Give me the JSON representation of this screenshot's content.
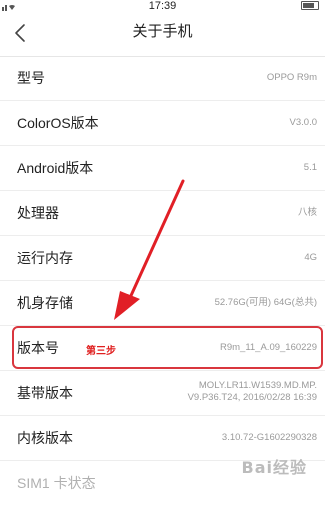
{
  "status_bar": {
    "time": "17:39"
  },
  "header": {
    "title": "关于手机"
  },
  "settings": {
    "items": [
      {
        "label": "型号",
        "value": "OPPO R9m"
      },
      {
        "label": "ColorOS版本",
        "value": "V3.0.0"
      },
      {
        "label": "Android版本",
        "value": "5.1"
      },
      {
        "label": "处理器",
        "value": "八核"
      },
      {
        "label": "运行内存",
        "value": "4G"
      },
      {
        "label": "机身存储",
        "value": "52.76G(可用)   64G(总共)"
      },
      {
        "label": "版本号",
        "value": "R9m_11_A.09_160229"
      },
      {
        "label": "基带版本",
        "value_line1": "MOLY.LR11.W1539.MD.MP.",
        "value_line2": "V9.P36.T24, 2016/02/28 16:39"
      },
      {
        "label": "内核版本",
        "value": "3.10.72-G1602290328"
      },
      {
        "label": "SIM1 卡状态",
        "value": ""
      }
    ]
  },
  "annotation": {
    "step_label": "第三步",
    "color": "#d9363e"
  },
  "watermark": {
    "text": "Bai经验"
  }
}
